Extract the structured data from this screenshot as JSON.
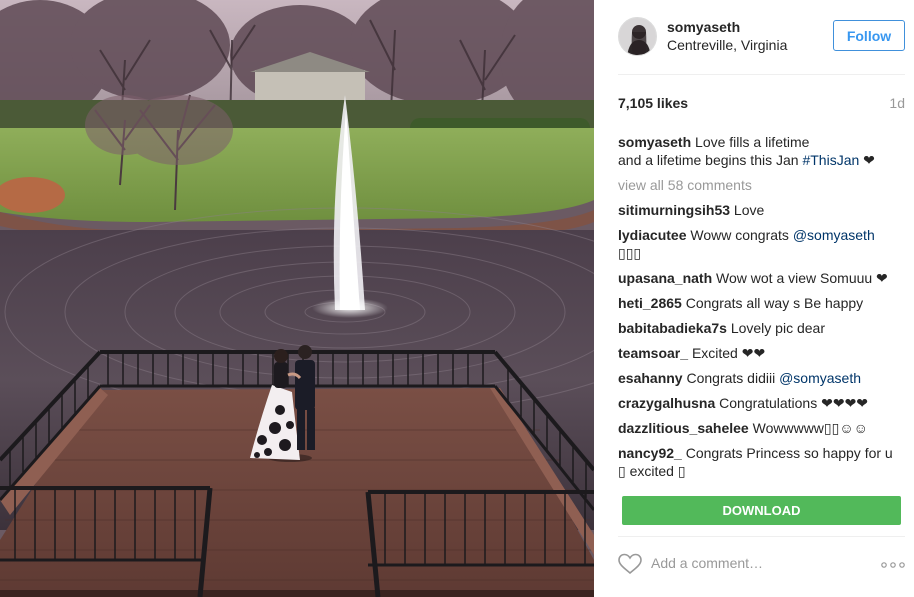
{
  "post": {
    "username": "somyaseth",
    "location": "Centreville, Virginia",
    "follow_label": "Follow",
    "likes": "7,105 likes",
    "time_ago": "1d",
    "caption_user": "somyaseth",
    "caption_text_1": "Love fills a lifetime",
    "caption_text_2": "and a lifetime begins this Jan",
    "caption_hashtag": "#ThisJan",
    "caption_heart": "❤",
    "view_all": "view all 58 comments",
    "download_label": "DOWNLOAD",
    "add_comment_placeholder": "Add a comment…"
  },
  "comments": [
    {
      "user": "sitimurningsih53",
      "text": "Love"
    },
    {
      "user": "lydiacutee",
      "text": "Woww congrats",
      "mention": "@somyaseth",
      "text_after": "▯▯▯"
    },
    {
      "user": "upasana_nath",
      "text": "Wow wot a view Somuuu ❤"
    },
    {
      "user": "heti_2865",
      "text": "Congrats all way s Be happy"
    },
    {
      "user": "babitabadieka7s",
      "text": "Lovely pic dear"
    },
    {
      "user": "teamsoar_",
      "text": "Excited ❤❤"
    },
    {
      "user": "esahanny",
      "text": "Congrats didiii",
      "mention": "@somyaseth"
    },
    {
      "user": "crazygalhusna",
      "text": "Congratulations ❤❤❤❤"
    },
    {
      "user": "dazzlitious_sahelee",
      "text": "Wowwwww▯▯☺☺"
    },
    {
      "user": "nancy92_",
      "text": "Congrats Princess so happy for u ▯ excited ▯"
    }
  ],
  "icons": {
    "heart": "heart-outline-icon",
    "more": "more-options-icon"
  },
  "colors": {
    "follow_blue": "#3897f0",
    "download_green": "#52b95a",
    "mention": "#003569",
    "muted": "#999999"
  }
}
